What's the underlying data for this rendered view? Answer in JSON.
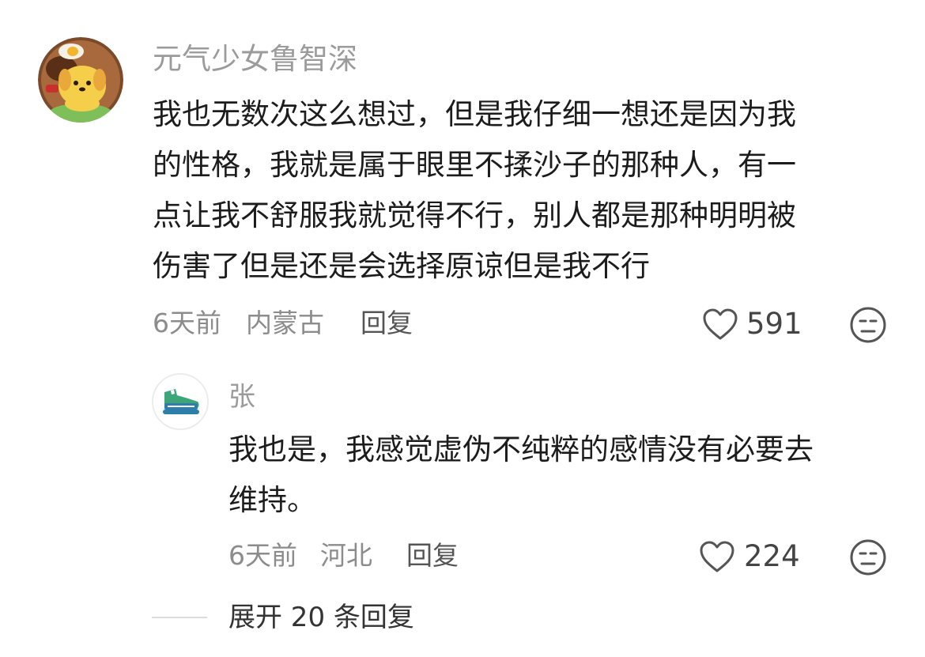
{
  "comment": {
    "username": "元气少女鲁智深",
    "lines": [
      "我也无数次这么想过，但是我仔细一想还是因为我",
      "的性格，我就是属于眼里不揉沙子的那种人，有一",
      "点让我不舒服我就觉得不行，别人都是那种明明被",
      "伤害了但是还是会选择原谅但是我不行"
    ],
    "time": "6天前",
    "location": "内蒙古",
    "reply_label": "回复",
    "likes": "591",
    "avatar_icon": "cartoon-dog-avatar",
    "like_icon": "heart-icon",
    "dislike_icon": "meh-face-icon"
  },
  "reply": {
    "username": "张",
    "lines": [
      "我也是，我感觉虚伪不纯粹的感情没有必要去",
      "维持。"
    ],
    "time": "6天前",
    "location": "河北",
    "reply_label": "回复",
    "likes": "224",
    "avatar_icon": "sneaker-avatar"
  },
  "expand": {
    "label": "展开 20 条回复"
  },
  "colors": {
    "meta_gray": "#8c8c8c",
    "text": "#1c1c1c",
    "sneaker_blue": "#2d7ea8",
    "sneaker_green": "#35c07a"
  }
}
